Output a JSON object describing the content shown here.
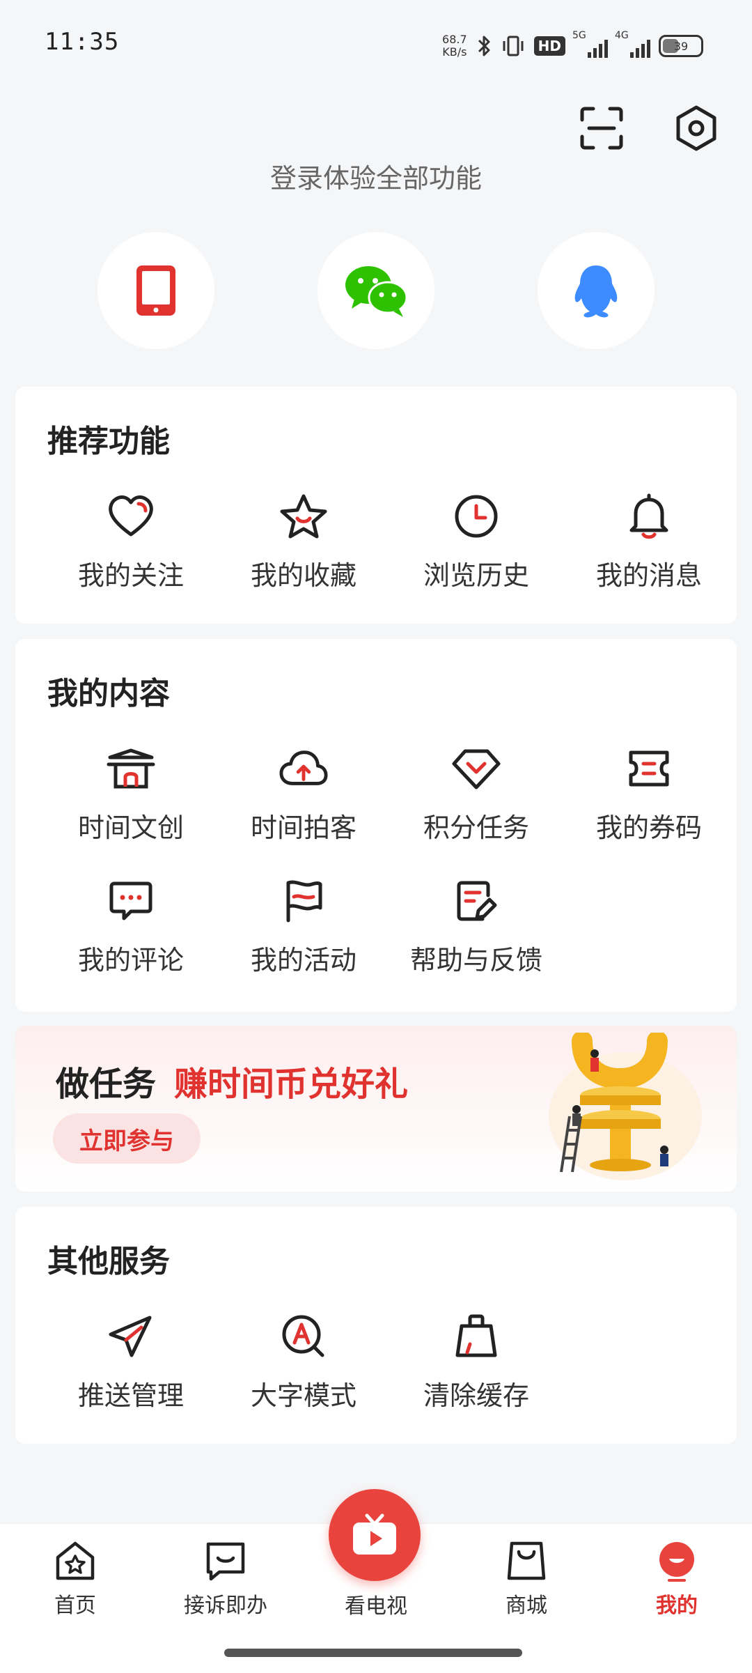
{
  "status_bar": {
    "time": "11:35",
    "net_speed_value": "68.7",
    "net_speed_unit": "KB/s",
    "hd_badge": "HD",
    "signal1_label": "5G",
    "signal2_label": "4G",
    "battery": "39"
  },
  "header": {
    "login_prompt": "登录体验全部功能"
  },
  "recommended": {
    "title": "推荐功能",
    "items": [
      {
        "label": "我的关注",
        "icon": "heart-icon"
      },
      {
        "label": "我的收藏",
        "icon": "star-icon"
      },
      {
        "label": "浏览历史",
        "icon": "clock-icon"
      },
      {
        "label": "我的消息",
        "icon": "bell-icon"
      }
    ]
  },
  "my_content": {
    "title": "我的内容",
    "items": [
      {
        "label": "时间文创",
        "icon": "pavilion-icon"
      },
      {
        "label": "时间拍客",
        "icon": "cloud-upload-icon"
      },
      {
        "label": "积分任务",
        "icon": "diamond-icon"
      },
      {
        "label": "我的券码",
        "icon": "ticket-icon"
      },
      {
        "label": "我的评论",
        "icon": "comment-icon"
      },
      {
        "label": "我的活动",
        "icon": "flag-icon"
      },
      {
        "label": "帮助与反馈",
        "icon": "feedback-icon"
      }
    ]
  },
  "banner": {
    "title_prefix": "做任务",
    "title_highlight": "赚时间币兑好礼",
    "button": "立即参与"
  },
  "other_services": {
    "title": "其他服务",
    "items": [
      {
        "label": "推送管理",
        "icon": "send-icon"
      },
      {
        "label": "大字模式",
        "icon": "large-text-icon"
      },
      {
        "label": "清除缓存",
        "icon": "broom-icon"
      }
    ]
  },
  "bottom_nav": {
    "items": [
      {
        "label": "首页",
        "icon": "home-icon"
      },
      {
        "label": "接诉即办",
        "icon": "message-box-icon"
      },
      {
        "label": "看电视",
        "icon": "tv-icon"
      },
      {
        "label": "商城",
        "icon": "shopping-bag-icon"
      },
      {
        "label": "我的",
        "icon": "profile-icon"
      }
    ],
    "active": "我的"
  },
  "colors": {
    "accent": "#e0322f",
    "background": "#f5f6f8",
    "wechat": "#2dc100",
    "qq": "#3d8bff"
  }
}
